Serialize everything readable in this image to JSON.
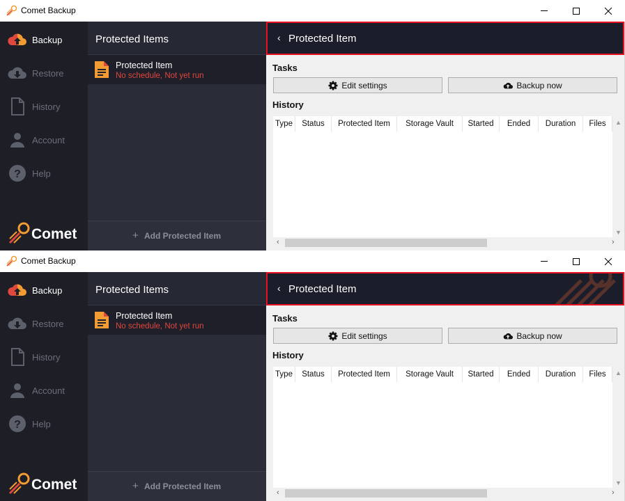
{
  "window": {
    "title": "Comet Backup",
    "controls": {
      "minimize": "minimize",
      "maximize": "maximize",
      "close": "close"
    }
  },
  "sidebar": {
    "items": [
      {
        "label": "Backup",
        "icon": "cloud-upload-icon",
        "active": true
      },
      {
        "label": "Restore",
        "icon": "cloud-download-icon",
        "active": false
      },
      {
        "label": "History",
        "icon": "document-icon",
        "active": false
      },
      {
        "label": "Account",
        "icon": "user-icon",
        "active": false
      },
      {
        "label": "Help",
        "icon": "help-icon",
        "active": false
      }
    ],
    "brand": "Comet"
  },
  "items_panel": {
    "header": "Protected Items",
    "item": {
      "name": "Protected Item",
      "status": "No schedule, Not yet run"
    },
    "add_label": "Add Protected Item"
  },
  "detail": {
    "back": "‹",
    "title": "Protected Item",
    "tasks_label": "Tasks",
    "edit_settings": "Edit settings",
    "backup_now": "Backup now",
    "history_label": "History",
    "columns": [
      "Type",
      "Status",
      "Protected Item",
      "Storage Vault",
      "Started",
      "Ended",
      "Duration",
      "Files"
    ]
  },
  "colors": {
    "accent": "#f39c34",
    "status_red": "#e0473f",
    "highlight_border": "#e81123",
    "sidebar_bg": "#1d1e26",
    "panel_bg": "#2a2c38"
  }
}
